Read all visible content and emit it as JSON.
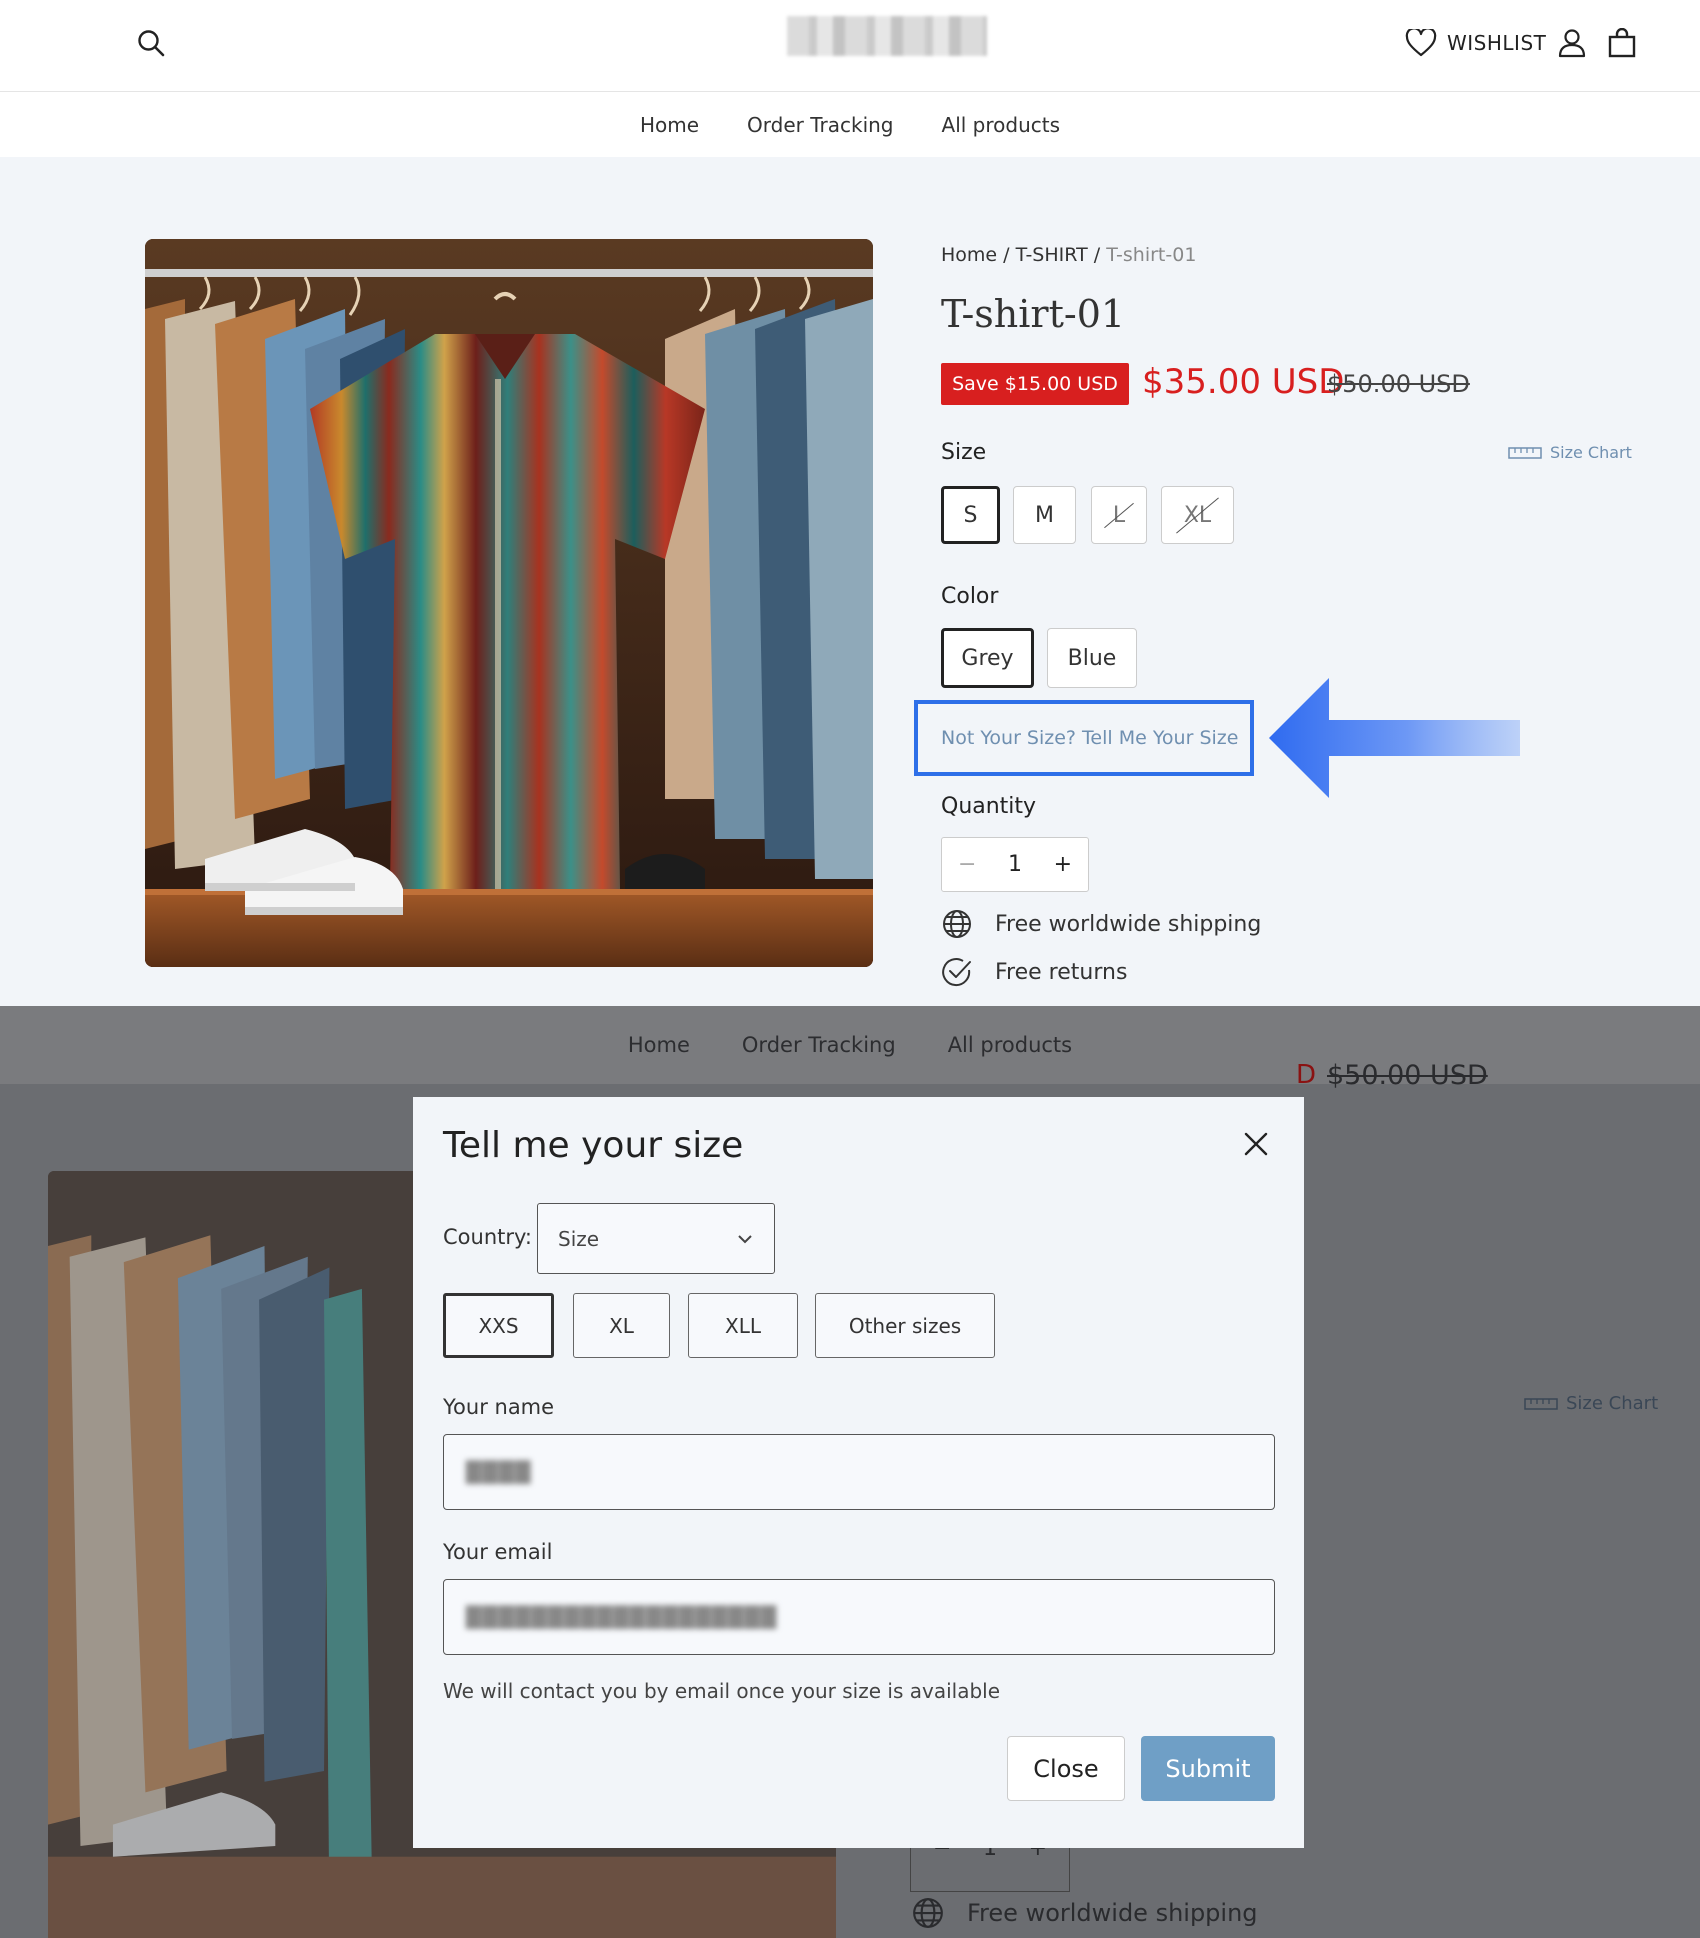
{
  "header": {
    "wishlist_label": "WISHLIST",
    "nav": [
      "Home",
      "Order Tracking",
      "All products"
    ]
  },
  "product": {
    "breadcrumb": {
      "home": "Home",
      "sep1": " / ",
      "category": "T-SHIRT",
      "sep2": " / ",
      "current": "T-shirt-01"
    },
    "title": "T-shirt-01",
    "save_badge": "Save $15.00 USD",
    "price": "$35.00 USD",
    "compare_price": "$50.00 USD",
    "size_label": "Size",
    "size_chart_label": "Size Chart",
    "sizes": [
      {
        "label": "S",
        "selected": true,
        "available": true
      },
      {
        "label": "M",
        "selected": false,
        "available": true
      },
      {
        "label": "L",
        "selected": false,
        "available": false
      },
      {
        "label": "XL",
        "selected": false,
        "available": false
      }
    ],
    "color_label": "Color",
    "colors": [
      {
        "label": "Grey",
        "selected": true
      },
      {
        "label": "Blue",
        "selected": false
      }
    ],
    "not_your_size_link": "Not Your Size? Tell Me Your Size",
    "quantity_label": "Quantity",
    "quantity_value": "1",
    "qty_minus": "−",
    "qty_plus": "+",
    "perks": [
      "Free worldwide shipping",
      "Free returns"
    ]
  },
  "overlay_background": {
    "nav": [
      "Home",
      "Order Tracking",
      "All products"
    ],
    "price_fragment": "D",
    "compare_price": "$50.00 USD",
    "size_chart_label": "Size Chart",
    "quantity_value": "1",
    "qty_minus": "−",
    "qty_plus": "+",
    "perk": "Free worldwide shipping"
  },
  "modal": {
    "title": "Tell me your size",
    "country_label": "Country:",
    "country_select_value": "Size",
    "size_options": [
      {
        "label": "XXS",
        "selected": true
      },
      {
        "label": "XL",
        "selected": false
      },
      {
        "label": "XLL",
        "selected": false
      },
      {
        "label": "Other sizes",
        "selected": false
      }
    ],
    "name_label": "Your name",
    "name_value": "████",
    "email_label": "Your email",
    "email_value": "███████████████████",
    "note": "We will contact you by email once your size is available",
    "close_button": "Close",
    "submit_button": "Submit"
  },
  "colors": {
    "sale_red": "#d81f1f",
    "link_blue_gray": "#6f8fb0",
    "highlight_blue": "#2e6fe8",
    "submit_blue": "#6f9fc6",
    "page_bg": "#f2f5f9"
  },
  "icons": [
    "search-icon",
    "heart-icon",
    "user-icon",
    "bag-icon",
    "ruler-icon",
    "globe-icon",
    "check-circle-icon",
    "close-icon",
    "chevron-down-icon",
    "arrow-left-icon"
  ]
}
